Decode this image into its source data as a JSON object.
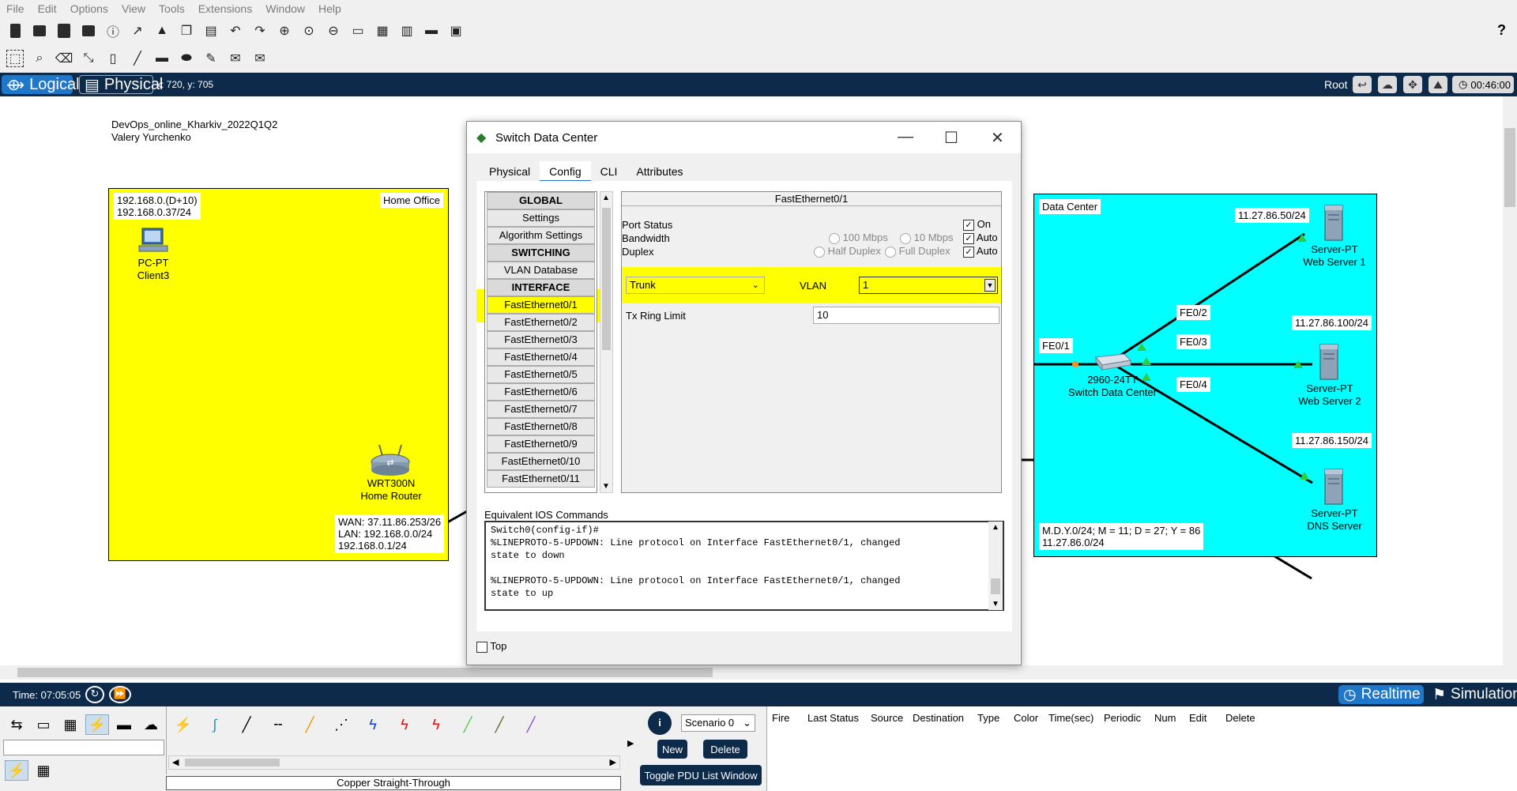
{
  "menu": [
    "File",
    "Edit",
    "Options",
    "View",
    "Tools",
    "Extensions",
    "Window",
    "Help"
  ],
  "toolbar": {
    "help": "?"
  },
  "modes": {
    "logical": "Logical",
    "physical": "Physical",
    "coords": "x: 720, y: 705",
    "root": "Root",
    "clock": "00:46:00"
  },
  "workspace": {
    "note_line1": "DevOps_online_Kharkiv_2022Q1Q2",
    "note_line2": "Valery Yurchenko",
    "home": {
      "title": "Home Office",
      "ip_label1": "192.168.0.(D+10)",
      "ip_label2": "192.168.0.37/24",
      "pc_type": "PC-PT",
      "pc_name": "Client3",
      "router_type": "WRT300N",
      "router_name": "Home Router",
      "wan": "WAN: 37.11.86.253/26",
      "lan": "LAN: 192.168.0.0/24",
      "lan_ip": "192.168.0.1/24"
    },
    "datacenter": {
      "title": "Data Center",
      "fe01": "FE0/1",
      "fe02": "FE0/2",
      "fe03": "FE0/3",
      "fe04": "FE0/4",
      "switch_type": "2960-24TT",
      "switch_name": "Switch Data Center",
      "srv1_ip": "11.27.86.50/24",
      "srv1_type": "Server-PT",
      "srv1_name": "Web Server 1",
      "srv2_ip": "11.27.86.100/24",
      "srv2_type": "Server-PT",
      "srv2_name": "Web Server 2",
      "srv3_ip": "11.27.86.150/24",
      "srv3_type": "Server-PT",
      "srv3_name": "DNS Server",
      "formula1": "M.D.Y.0/24; M = 11; D = 27; Y = 86",
      "formula2": "11.27.86.0/24"
    }
  },
  "dialog": {
    "title": "Switch Data Center",
    "tabs": [
      "Physical",
      "Config",
      "CLI",
      "Attributes"
    ],
    "list": {
      "global": "GLOBAL",
      "settings": "Settings",
      "algorithm": "Algorithm Settings",
      "switching": "SWITCHING",
      "vlan_db": "VLAN Database",
      "interface": "INTERFACE",
      "ports": [
        "FastEthernet0/1",
        "FastEthernet0/2",
        "FastEthernet0/3",
        "FastEthernet0/4",
        "FastEthernet0/5",
        "FastEthernet0/6",
        "FastEthernet0/7",
        "FastEthernet0/8",
        "FastEthernet0/9",
        "FastEthernet0/10",
        "FastEthernet0/11"
      ]
    },
    "iface": {
      "title": "FastEthernet0/1",
      "port_status": "Port Status",
      "on": "On",
      "bandwidth": "Bandwidth",
      "bw100": "100 Mbps",
      "bw10": "10 Mbps",
      "auto": "Auto",
      "duplex": "Duplex",
      "half": "Half Duplex",
      "full": "Full Duplex",
      "mode": "Trunk",
      "vlan_label": "VLAN",
      "vlan": "1",
      "tx_label": "Tx Ring Limit",
      "tx": "10"
    },
    "ios_label": "Equivalent IOS Commands",
    "ios_text": "Switch0(config-if)#\n%LINEPROTO-5-UPDOWN: Line protocol on Interface FastEthernet0/1, changed\nstate to down\n\n%LINEPROTO-5-UPDOWN: Line protocol on Interface FastEthernet0/1, changed\nstate to up",
    "top": "Top"
  },
  "bottom": {
    "time": "Time: 07:05:05",
    "realtime": "Realtime",
    "simulation": "Simulation",
    "cable": "Copper Straight-Through",
    "scenario": "Scenario 0",
    "new": "New",
    "delete": "Delete",
    "toggle": "Toggle PDU List Window",
    "pdu_headers": [
      "Fire",
      "Last Status",
      "Source",
      "Destination",
      "Type",
      "Color",
      "Time(sec)",
      "Periodic",
      "Num",
      "Edit",
      "Delete"
    ]
  }
}
